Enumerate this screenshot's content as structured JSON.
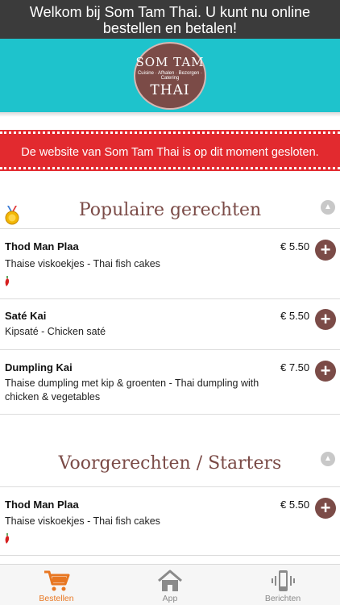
{
  "banner": {
    "line1": "Welkom bij Som Tam Thai. U kunt nu online",
    "line2": "bestellen en betalen!"
  },
  "logo": {
    "line1": "SOM TAM",
    "tagline": "Cuisine · Afhalen · Bezorgen · Catering",
    "line2": "THAI"
  },
  "notice": "De website van Som Tam Thai is op dit moment gesloten.",
  "sections": [
    {
      "title": "Populaire gerechten",
      "items": [
        {
          "name": "Thod Man Plaa",
          "desc": "Thaise viskoekjes - Thai fish cakes",
          "price": "€ 5.50",
          "spicy": true
        },
        {
          "name": "Saté Kai",
          "desc": "Kipsaté - Chicken saté",
          "price": "€ 5.50",
          "spicy": false
        },
        {
          "name": "Dumpling Kai",
          "desc": "Thaise dumpling met kip & groenten - Thai dumpling with chicken & vegetables",
          "price": "€ 7.50",
          "spicy": false
        }
      ]
    },
    {
      "title": "Voorgerechten / Starters",
      "items": [
        {
          "name": "Thod Man Plaa",
          "desc": "Thaise viskoekjes - Thai fish cakes",
          "price": "€ 5.50",
          "spicy": true
        }
      ]
    }
  ],
  "tabs": [
    {
      "label": "Bestellen",
      "icon": "cart-icon",
      "active": true
    },
    {
      "label": "App",
      "icon": "home-icon",
      "active": false
    },
    {
      "label": "Berichten",
      "icon": "phone-vibrate-icon",
      "active": false
    }
  ],
  "colors": {
    "banner_bg": "#3b3b3b",
    "header_bg": "#1ec3cc",
    "brand_brown": "#7b4b47",
    "notice_red": "#e22a2f",
    "active_tab": "#e87722"
  }
}
